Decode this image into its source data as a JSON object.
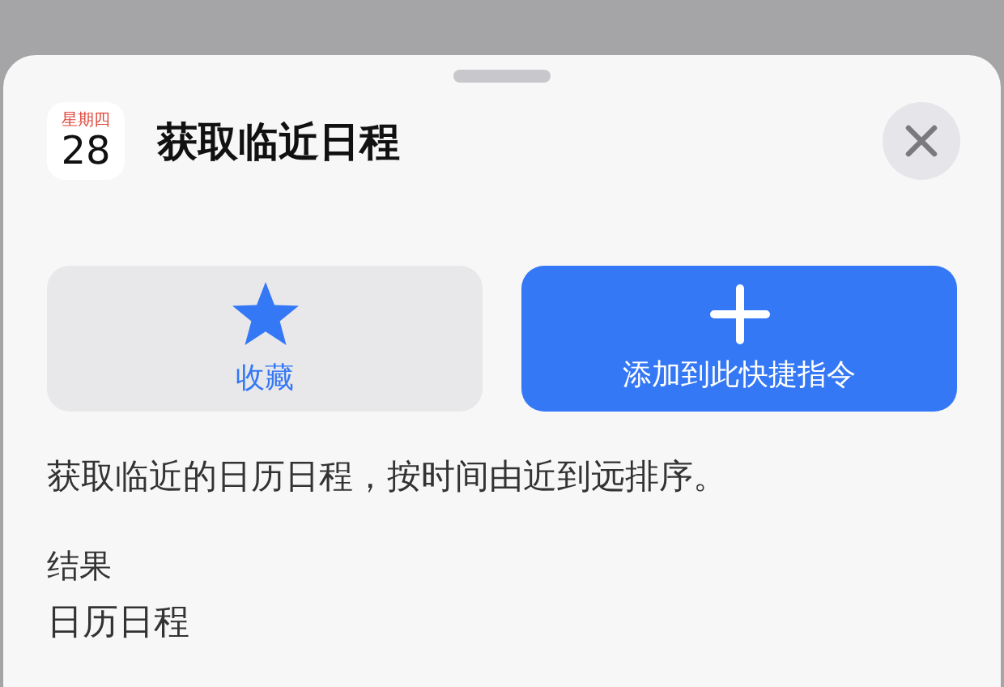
{
  "sheet": {
    "app_icon": {
      "weekday": "星期四",
      "day": "28"
    },
    "title": "获取临近日程"
  },
  "actions": [
    {
      "kind": "favorite",
      "label": "收藏"
    },
    {
      "kind": "add",
      "label": "添加到此快捷指令"
    }
  ],
  "description": "获取临近的日历日程，按时间由近到远排序。",
  "result": {
    "heading": "结果",
    "value": "日历日程"
  }
}
